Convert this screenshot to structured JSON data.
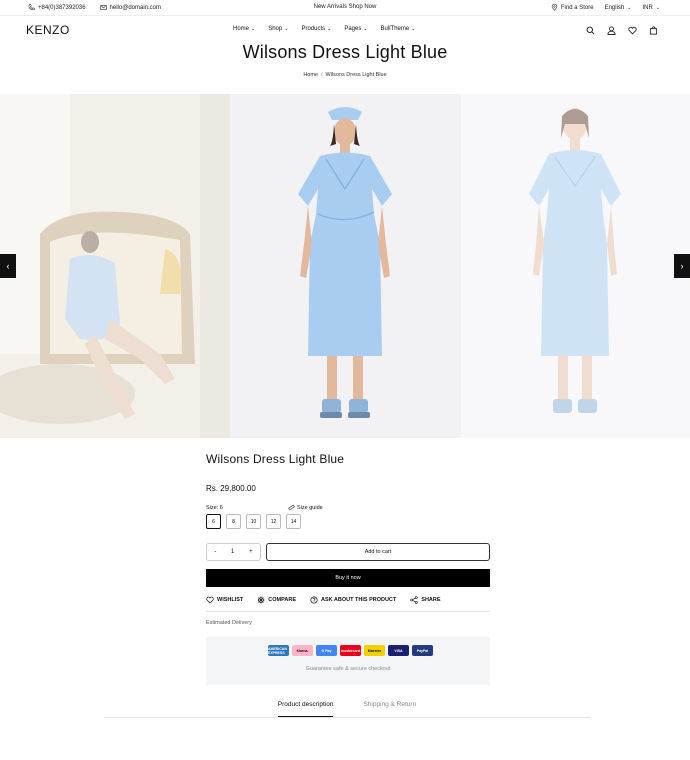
{
  "topbar": {
    "phone": "+84(0)387392036",
    "email": "hello@domain.com",
    "promo": "New Arrivals Shop Now",
    "find_store": "Find a Store",
    "language": "English",
    "currency": "INR"
  },
  "header": {
    "logo": "KENZO",
    "nav": [
      "Home",
      "Shop",
      "Products",
      "Pages",
      "BullTheme"
    ]
  },
  "page": {
    "title": "Wilsons Dress Light Blue",
    "breadcrumb": [
      "Home",
      "Wilsons Dress Light Blue"
    ]
  },
  "gallery": {
    "prev_icon": "chevron-left-icon",
    "next_icon": "chevron-right-icon",
    "prev_label": "‹",
    "next_label": "›"
  },
  "product": {
    "title": "Wilsons Dress Light Blue",
    "price": "Rs. 29,800.00",
    "size_label": "Size",
    "size_value": "6",
    "size_guide": "Size guide",
    "sizes": [
      "6",
      "8",
      "10",
      "12",
      "14"
    ],
    "selected_size": "6",
    "qty_minus": "-",
    "qty": "1",
    "qty_plus": "+",
    "add_to_cart": "Add to cart",
    "buy_now": "Buy it now",
    "actions": {
      "wishlist": "WISHLIST",
      "compare": "COMPARE",
      "ask": "ASK ABOUT THIS PRODUCT",
      "share": "SHARE"
    },
    "delivery": "Estimated Delivery"
  },
  "payment": {
    "methods": [
      "AMERICAN EXPRESS",
      "Klarna.",
      "G Pay",
      "mastercard",
      "Maestro",
      "VISA",
      "PayPal"
    ],
    "guarantee": "Guarantee safe & secure checkout"
  },
  "tabs": [
    "Product description",
    "Shipping & Return"
  ],
  "colors": {
    "accent": "#000000",
    "dress_blue": "#a8cdf0"
  }
}
